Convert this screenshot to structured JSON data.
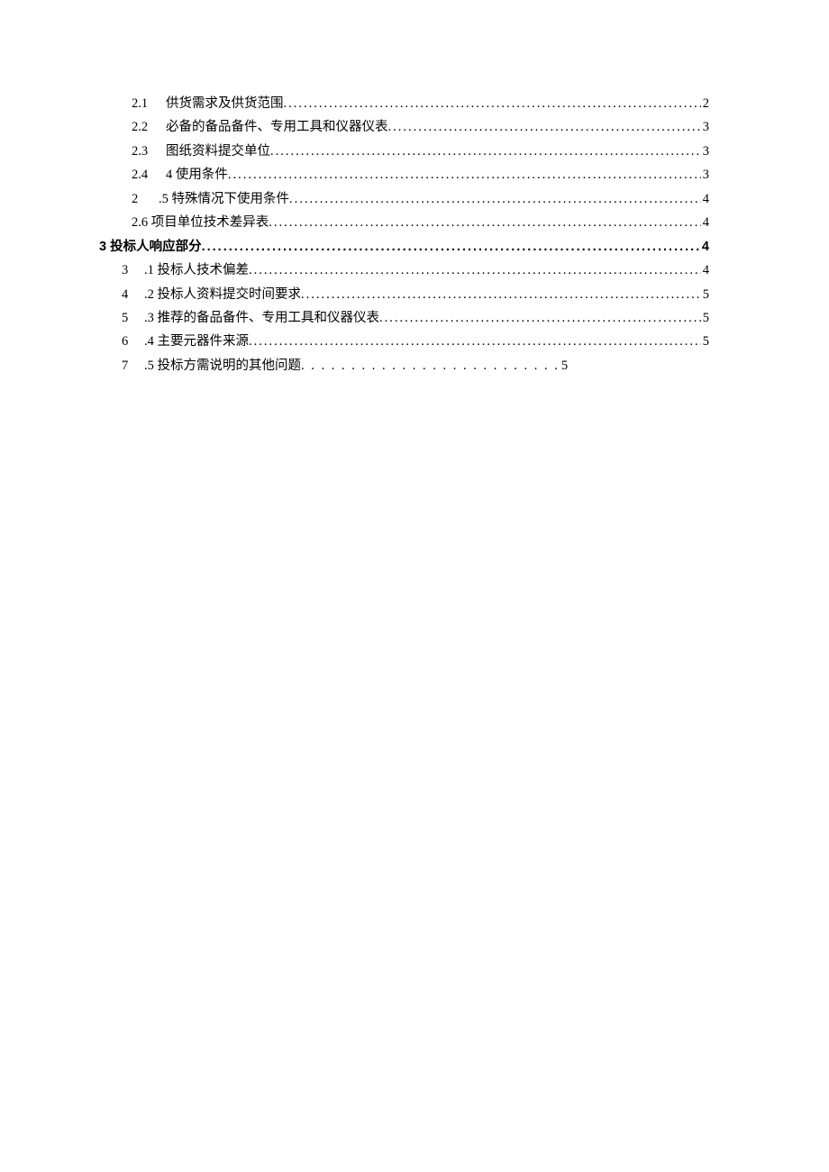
{
  "toc": {
    "lines": [
      {
        "indent": "indent-a",
        "numClass": "num-w1",
        "num": "2.1",
        "label": "供货需求及供货范围 ",
        "page": "2",
        "bold": false,
        "full": true
      },
      {
        "indent": "indent-a",
        "numClass": "num-w1",
        "num": "2.2",
        "label": "必备的备品备件、专用工具和仪器仪表 ",
        "page": "3",
        "bold": false,
        "full": true
      },
      {
        "indent": "indent-a",
        "numClass": "num-w1",
        "num": "2.3",
        "label": "图纸资料提交单位 ",
        "page": "3",
        "bold": false,
        "full": true
      },
      {
        "indent": "indent-a",
        "numClass": "num-w1",
        "num": "2.4",
        "label": "4 使用条件",
        "page": "3",
        "bold": false,
        "full": true
      },
      {
        "indent": "indent-a",
        "numClass": "num-w2",
        "num": "2",
        "label": ".5 特殊情况下使用条件 ",
        "page": "4",
        "bold": false,
        "full": true
      },
      {
        "indent": "indent-a",
        "numClass": "",
        "num": "",
        "label": "2.6 项目单位技术差异表 ",
        "page": "4",
        "bold": false,
        "full": true
      },
      {
        "indent": "indent-b",
        "numClass": "",
        "num": "",
        "label": "3 投标人响应部分 ",
        "page": "4",
        "bold": true,
        "full": true
      },
      {
        "indent": "indent-c",
        "numClass": "num-w3",
        "num": "3",
        "label": ".1 投标人技术偏差 ",
        "page": "4",
        "bold": false,
        "full": true
      },
      {
        "indent": "indent-c",
        "numClass": "num-w3",
        "num": "4",
        "label": ".2 投标人资料提交时间要求 ",
        "page": "5",
        "bold": false,
        "full": true
      },
      {
        "indent": "indent-c",
        "numClass": "num-w3",
        "num": "5",
        "label": ".3 推荐的备品备件、专用工具和仪器仪表 ",
        "page": "5",
        "bold": false,
        "full": true
      },
      {
        "indent": "indent-c",
        "numClass": "num-w3",
        "num": "6",
        "label": ".4 主要元器件来源 ",
        "page": "5",
        "bold": false,
        "full": true
      },
      {
        "indent": "indent-c",
        "numClass": "num-w3",
        "num": "7",
        "label": ".5 投标方需说明的其他问题",
        "dots": ". . . . . . . . . . . . . . . . . . . . . . . . . .",
        "page": "5",
        "bold": false,
        "full": false
      }
    ]
  }
}
